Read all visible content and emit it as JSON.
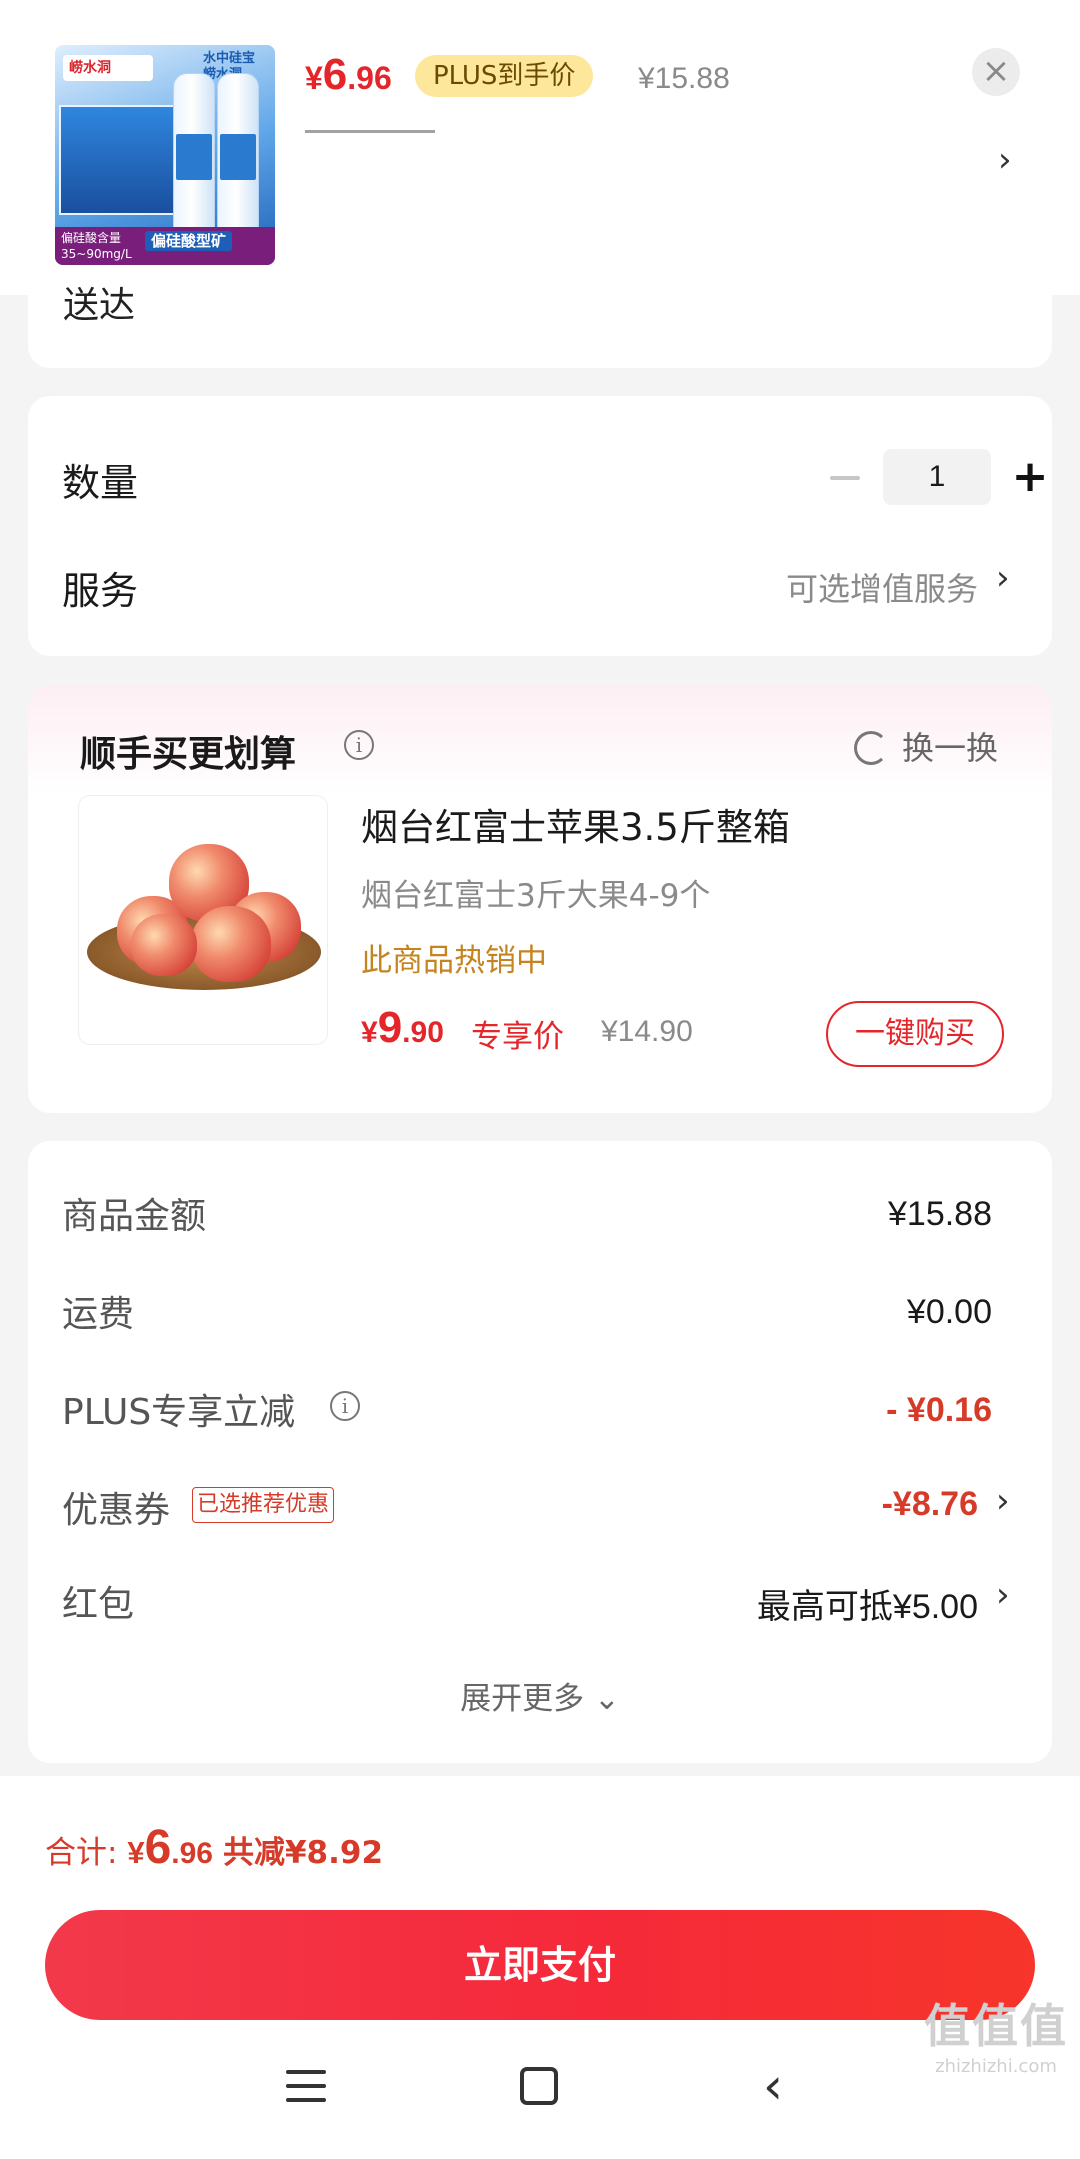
{
  "header": {
    "price_currency": "¥",
    "price_int": "6",
    "price_dec": ".96",
    "plus_badge": "PLUS到手价",
    "original_price": "¥15.88",
    "close_icon": "close-icon",
    "chevron": "›",
    "product_image": {
      "brand": "崂水洞",
      "slogan": "水中硅宝 崂水洞",
      "strip_text": "偏硅酸含量 35~90mg/L",
      "strip_tag": "偏硅酸型矿"
    }
  },
  "delivery": {
    "cut_text": "送达"
  },
  "quantity": {
    "label": "数量",
    "value": "1",
    "minus": "−",
    "plus": "+"
  },
  "service": {
    "label": "服务",
    "value": "可选增值服务",
    "chevron": "›"
  },
  "recommend": {
    "title": "顺手买更划算",
    "info_icon": "i",
    "swap_label": "换一换",
    "product": {
      "title": "烟台红富士苹果3.5斤整箱",
      "subtitle": "烟台红富士3斤大果4-9个",
      "hot": "此商品热销中",
      "price_currency": "¥",
      "price_int": "9",
      "price_dec": ".90",
      "exclusive": "专享价",
      "original_price": "¥14.90",
      "buy_button": "一键购买"
    }
  },
  "summary": {
    "rows": [
      {
        "label": "商品金额",
        "value": "¥15.88"
      },
      {
        "label": "运费",
        "value": "¥0.00"
      },
      {
        "label": "PLUS专享立减",
        "value": "- ¥0.16"
      },
      {
        "label": "优惠券",
        "tag": "已选推荐优惠",
        "value": "-¥8.76"
      },
      {
        "label": "红包",
        "value": "最高可抵¥5.00"
      }
    ],
    "expand": "展开更多 ⌄"
  },
  "footer": {
    "total_label": "合计: ",
    "total_currency": "¥",
    "total_int": "6",
    "total_dec": ".96",
    "total_reduce": "共减¥8.92",
    "pay_button": "立即支付",
    "nav_back": "‹"
  },
  "watermark": {
    "big": "值值值",
    "small": "zhizhizhi.com"
  },
  "colors": {
    "accent_red": "#e4262b",
    "plus_badge_bg": "#fde79a",
    "hot_orange": "#c58420"
  }
}
